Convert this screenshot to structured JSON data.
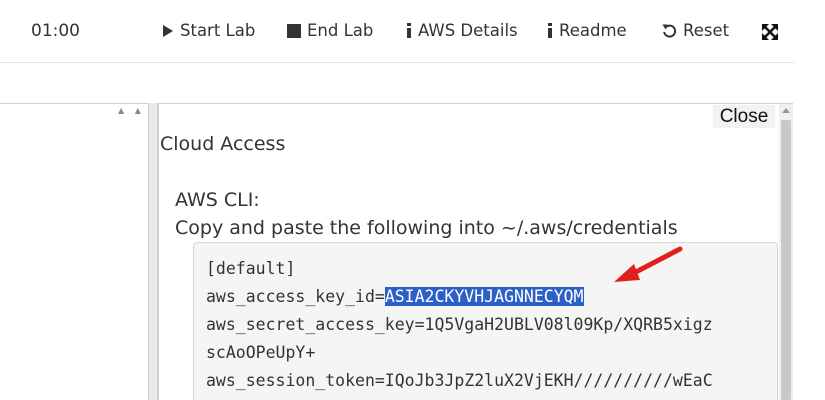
{
  "toolbar": {
    "timer": "01:00",
    "start_lab": "Start Lab",
    "end_lab": "End Lab",
    "aws_details": "AWS Details",
    "readme": "Readme",
    "reset": "Reset"
  },
  "panel": {
    "close_label": "Close",
    "heading": "Cloud Access",
    "cli_heading": "AWS CLI:",
    "cli_description": "Copy and paste the following into ~/.aws/credentials",
    "credentials": {
      "line1": "[default]",
      "key_id_label": "aws_access_key_id=",
      "key_id_value": "ASIA2CKYVHJAGNNECYQM",
      "secret_line": "aws_secret_access_key=1Q5VgaH2UBLV08l09Kp/XQRB5xigz",
      "secret_cont": "scAoOPeUpY+",
      "token_line": "aws_session_token=IQoJb3JpZ2luX2VjEKH//////////wEaC"
    }
  },
  "colors": {
    "selection": "#2b60c8",
    "arrow": "#e0201c"
  }
}
